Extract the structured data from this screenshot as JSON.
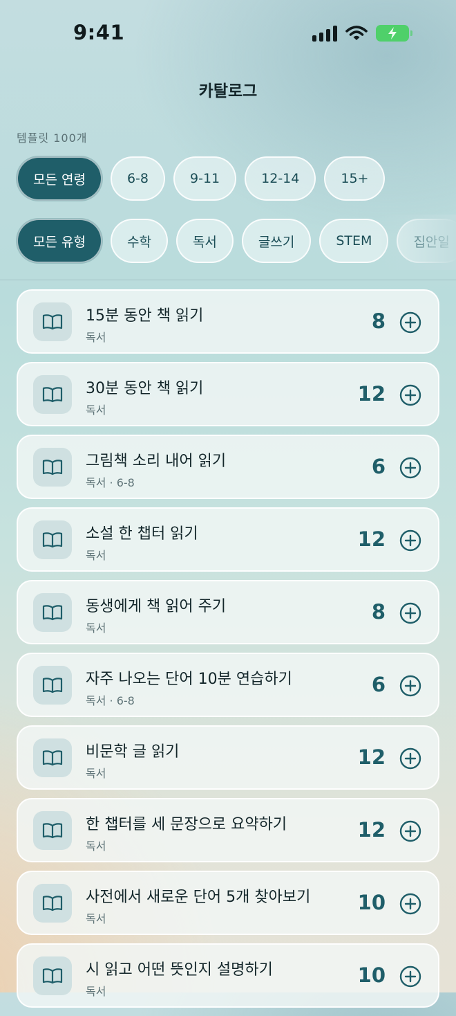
{
  "status_bar": {
    "time": "9:41"
  },
  "header": {
    "title": "카탈로그"
  },
  "template_count": "템플릿 100개",
  "age_filters": [
    {
      "label": "모든 연령",
      "active": true
    },
    {
      "label": "6-8",
      "active": false
    },
    {
      "label": "9-11",
      "active": false
    },
    {
      "label": "12-14",
      "active": false
    },
    {
      "label": "15+",
      "active": false
    }
  ],
  "type_filters": [
    {
      "label": "모든 유형",
      "active": true
    },
    {
      "label": "수학",
      "active": false
    },
    {
      "label": "독서",
      "active": false
    },
    {
      "label": "글쓰기",
      "active": false
    },
    {
      "label": "STEM",
      "active": false
    },
    {
      "label": "집안일",
      "active": false
    }
  ],
  "templates": [
    {
      "title": "15분 동안 책 읽기",
      "subtitle": "독서",
      "points": "8",
      "icon": "book-icon"
    },
    {
      "title": "30분 동안 책 읽기",
      "subtitle": "독서",
      "points": "12",
      "icon": "book-icon"
    },
    {
      "title": "그림책 소리 내어 읽기",
      "subtitle": "독서 · 6-8",
      "points": "6",
      "icon": "book-icon"
    },
    {
      "title": "소설 한 챕터 읽기",
      "subtitle": "독서",
      "points": "12",
      "icon": "book-icon"
    },
    {
      "title": "동생에게 책 읽어 주기",
      "subtitle": "독서",
      "points": "8",
      "icon": "book-icon"
    },
    {
      "title": "자주 나오는 단어 10분 연습하기",
      "subtitle": "독서 · 6-8",
      "points": "6",
      "icon": "book-icon"
    },
    {
      "title": "비문학 글 읽기",
      "subtitle": "독서",
      "points": "12",
      "icon": "book-icon"
    },
    {
      "title": "한 챕터를 세 문장으로 요약하기",
      "subtitle": "독서",
      "points": "12",
      "icon": "book-icon"
    },
    {
      "title": "사전에서 새로운 단어 5개 찾아보기",
      "subtitle": "독서",
      "points": "10",
      "icon": "book-icon"
    },
    {
      "title": "시 읽고 어떤 뜻인지 설명하기",
      "subtitle": "독서",
      "points": "10",
      "icon": "book-icon"
    }
  ],
  "colors": {
    "accent": "#1f5e69",
    "battery": "#4fd06a"
  }
}
